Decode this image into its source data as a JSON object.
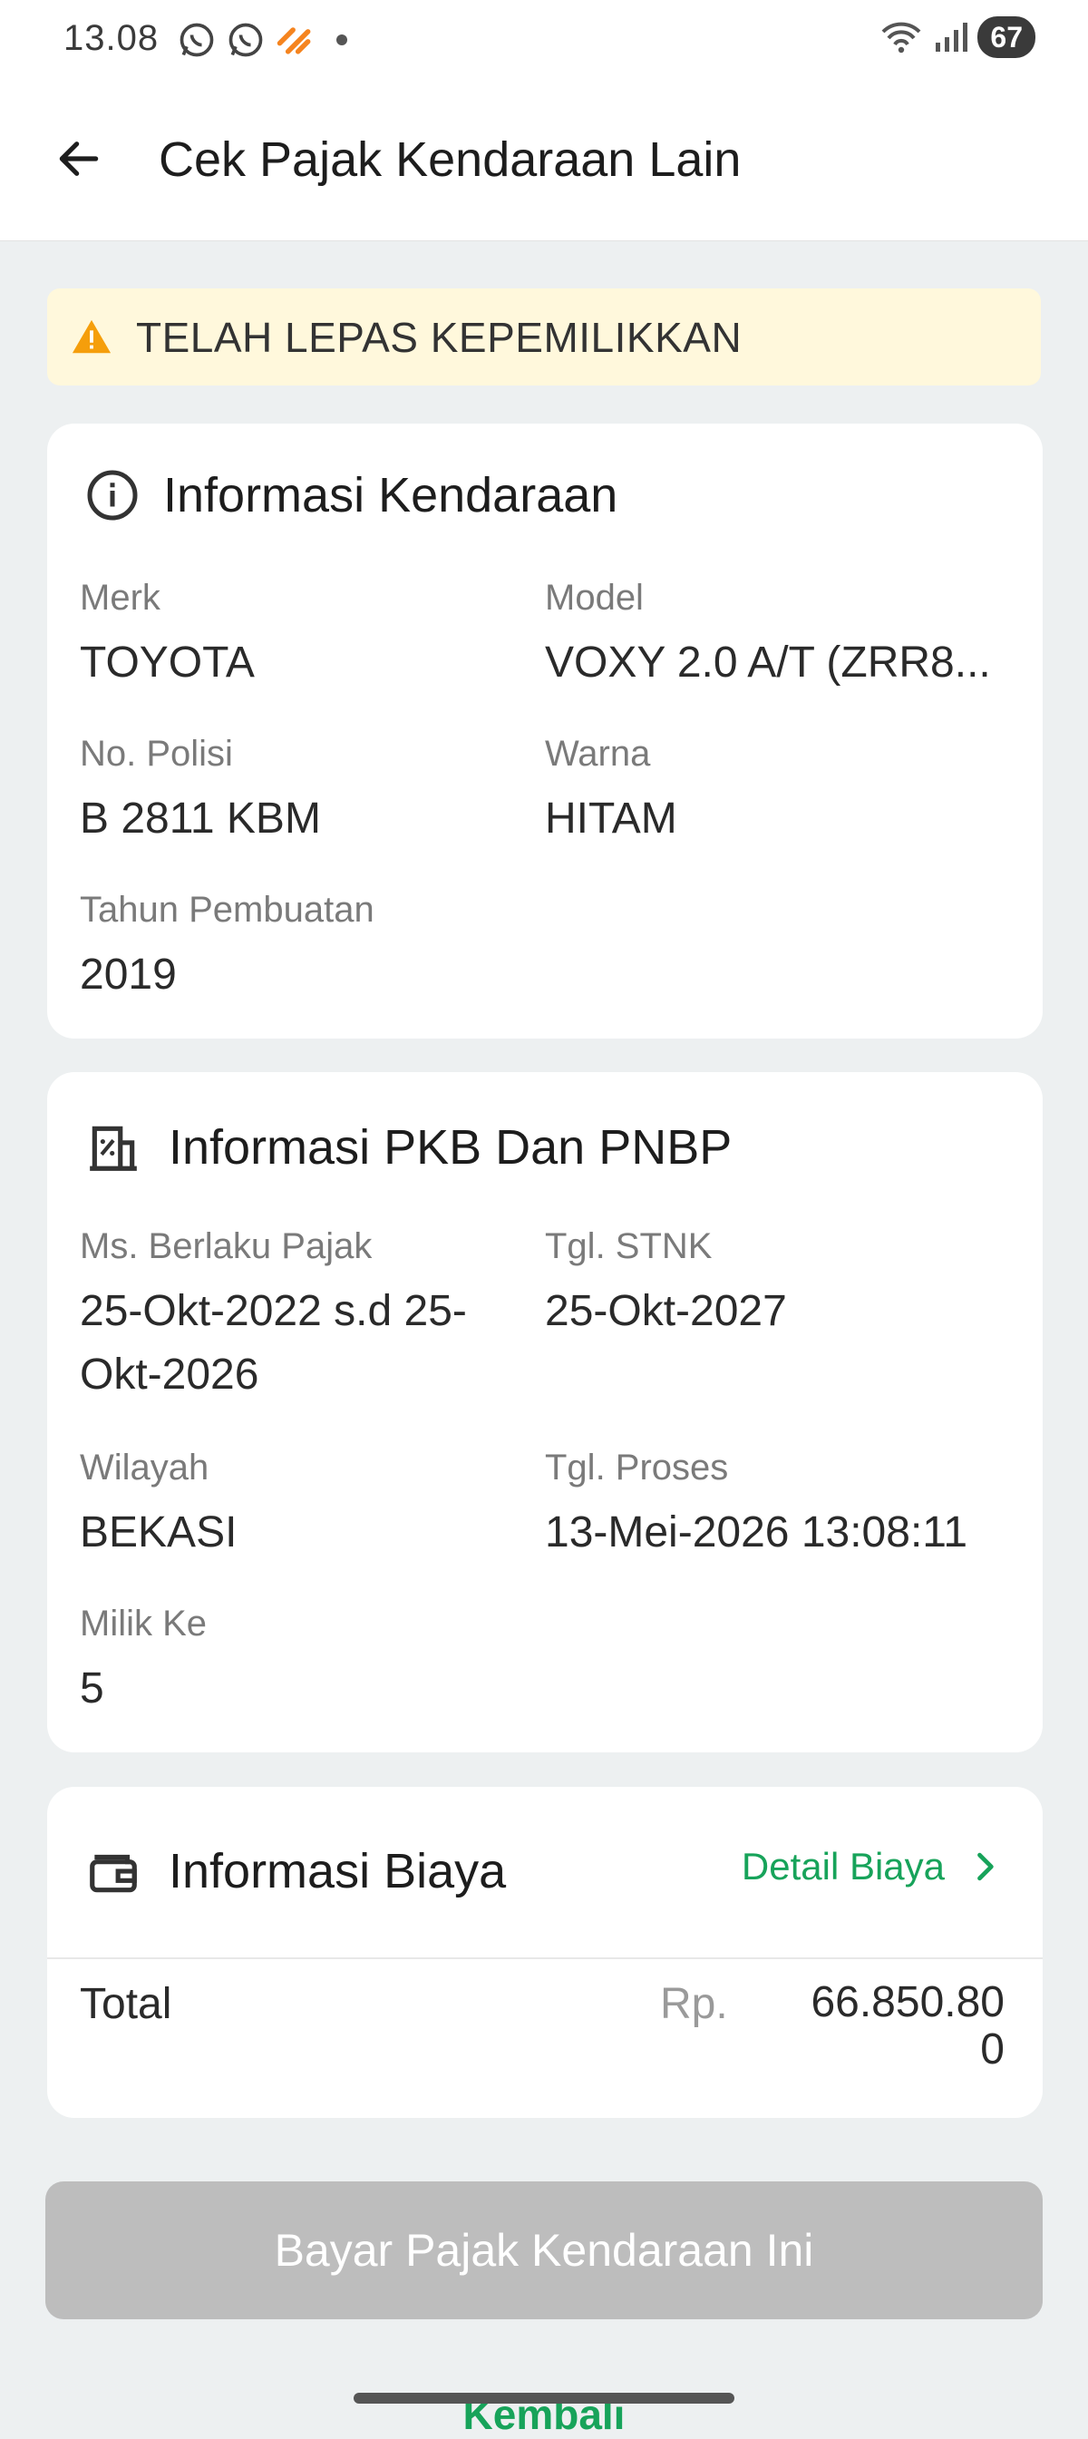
{
  "status_bar": {
    "time": "13.08",
    "battery": "67"
  },
  "header": {
    "title": "Cek Pajak Kendaraan Lain"
  },
  "alert": {
    "text": "TELAH LEPAS KEPEMILIKKAN",
    "color": "#fff8dc"
  },
  "vehicle": {
    "title": "Informasi Kendaraan",
    "merk": {
      "label": "Merk",
      "value": "TOYOTA"
    },
    "model": {
      "label": "Model",
      "value": "VOXY 2.0 A/T (ZRR8..."
    },
    "polisi": {
      "label": "No. Polisi",
      "value": "B 2811 KBM"
    },
    "warna": {
      "label": "Warna",
      "value": "HITAM"
    },
    "tahun": {
      "label": "Tahun Pembuatan",
      "value": "2019"
    }
  },
  "pkb": {
    "title": "Informasi PKB Dan PNBP",
    "masa_berlaku": {
      "label": "Ms. Berlaku Pajak",
      "value": "25-Okt-2022 s.d 25-Okt-2026"
    },
    "tgl_stnk": {
      "label": "Tgl. STNK",
      "value": "25-Okt-2027"
    },
    "wilayah": {
      "label": "Wilayah",
      "value": "BEKASI"
    },
    "tgl_proses": {
      "label": "Tgl. Proses",
      "value": "13-Mei-2026 13:08:11"
    },
    "milik_ke": {
      "label": "Milik Ke",
      "value": "5"
    }
  },
  "biaya": {
    "title": "Informasi Biaya",
    "detail_link": "Detail Biaya",
    "total_label": "Total",
    "currency": "Rp.",
    "total_value": "66.850.800"
  },
  "actions": {
    "pay_button": "Bayar Pajak Kendaraan Ini",
    "back_link": "Kembali"
  },
  "colors": {
    "accent": "#17a35a",
    "disabled": "#bdbdbd",
    "warning": "#f59e0b"
  }
}
